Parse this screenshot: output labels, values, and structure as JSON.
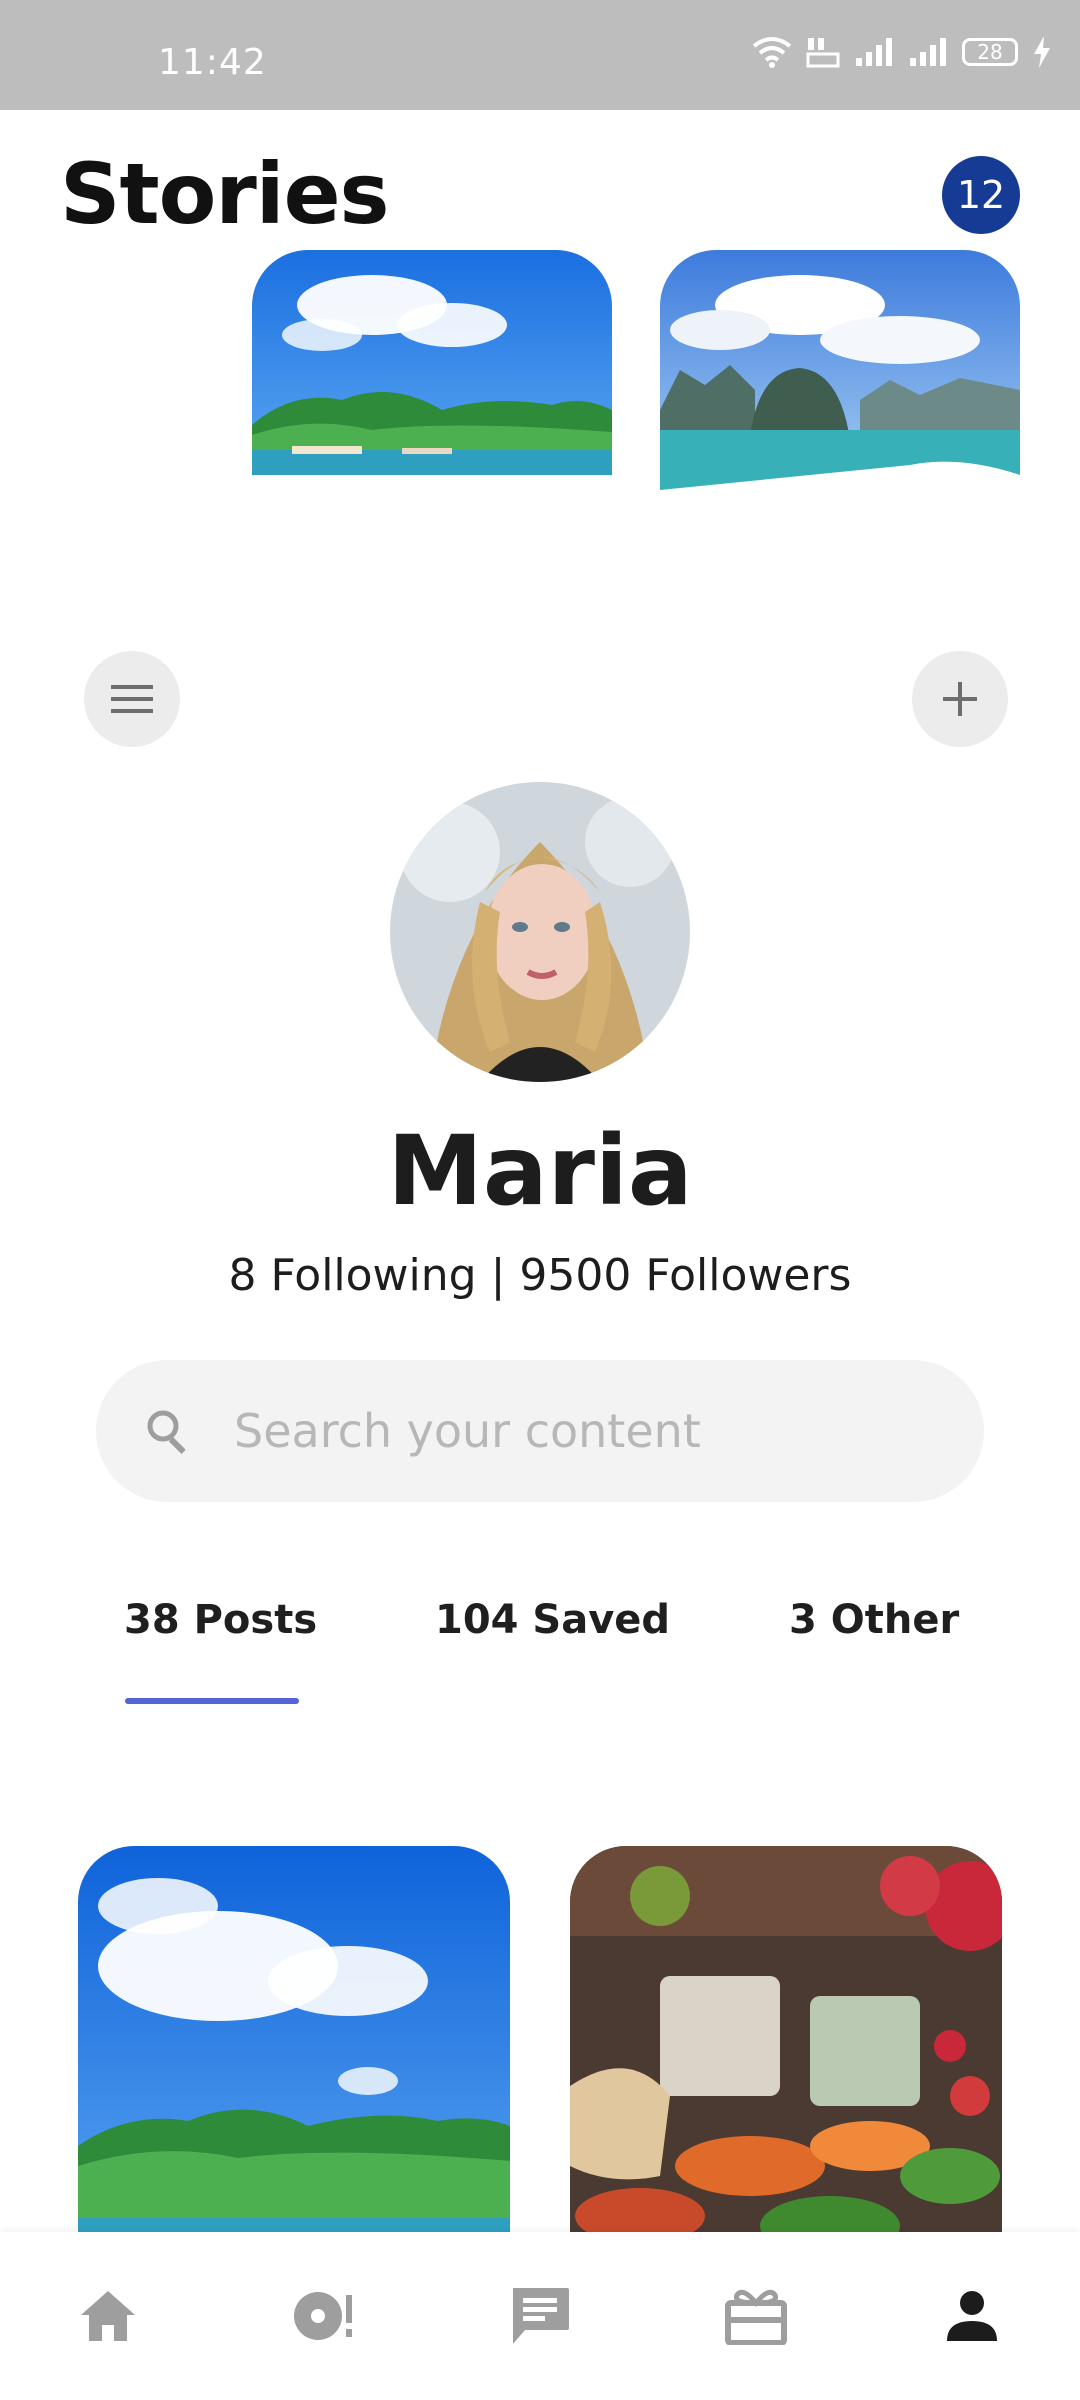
{
  "status_bar": {
    "time": "11:42",
    "battery": "28",
    "icons": [
      "wifi-icon",
      "volte-icon",
      "signal-icon",
      "signal-icon",
      "battery-icon",
      "charging-icon"
    ]
  },
  "header": {
    "title": "Stories",
    "badge_count": "12"
  },
  "stories": [
    {
      "image": "island-landscape"
    },
    {
      "image": "bay-karst-landscape"
    }
  ],
  "actions": {
    "menu_icon": "menu-icon",
    "add_icon": "plus-icon"
  },
  "profile": {
    "name": "Maria",
    "stats": "8 Following | 9500 Followers"
  },
  "search": {
    "placeholder": "Search your content",
    "value": ""
  },
  "tabs": [
    {
      "label": "38 Posts",
      "active": true
    },
    {
      "label": "104 Saved",
      "active": false
    },
    {
      "label": "3 Other",
      "active": false
    }
  ],
  "posts": [
    {
      "image": "island-landscape"
    },
    {
      "image": "vegetable-market"
    }
  ],
  "bottom_nav": [
    {
      "icon": "home-icon",
      "active": false
    },
    {
      "icon": "explore-icon",
      "active": false
    },
    {
      "icon": "chat-icon",
      "active": false
    },
    {
      "icon": "gift-icon",
      "active": false
    },
    {
      "icon": "profile-icon",
      "active": true
    }
  ],
  "colors": {
    "accent": "#5264d6",
    "badge": "#153b94",
    "status_bar": "#bdbdbd",
    "inactive_icon": "#9e9e9e",
    "active_icon": "#1c1c1c"
  }
}
